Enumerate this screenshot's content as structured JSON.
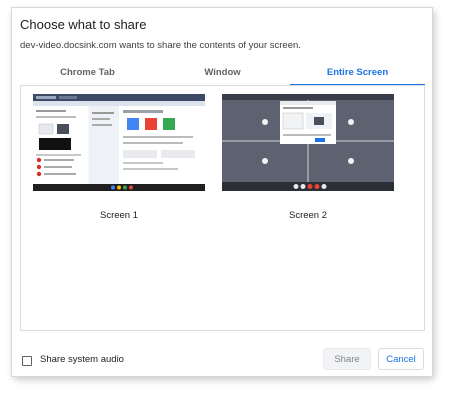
{
  "dialog": {
    "title": "Choose what to share",
    "subtitle": "dev-video.docsink.com wants to share the contents of your screen."
  },
  "tabs": [
    {
      "label": "Chrome Tab",
      "selected": false
    },
    {
      "label": "Window",
      "selected": false
    },
    {
      "label": "Entire Screen",
      "selected": true
    }
  ],
  "screens": [
    {
      "label": "Screen 1"
    },
    {
      "label": "Screen 2"
    }
  ],
  "footer": {
    "audio_label": "Share system audio",
    "audio_checked": false,
    "share_label": "Share",
    "cancel_label": "Cancel"
  },
  "colors": {
    "accent": "#1a73e8",
    "tab_inactive": "#5f6368",
    "border": "#dadce0"
  }
}
